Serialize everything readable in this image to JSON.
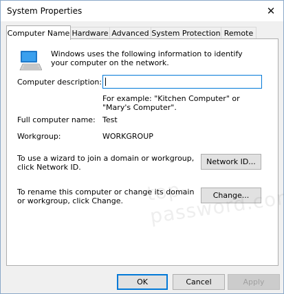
{
  "window": {
    "title": "System Properties"
  },
  "tabs": [
    {
      "label": "Computer Name",
      "active": true
    },
    {
      "label": "Hardware"
    },
    {
      "label": "Advanced"
    },
    {
      "label": "System Protection"
    },
    {
      "label": "Remote"
    }
  ],
  "computer_name": {
    "intro": "Windows uses the following information to identify your computer on the network.",
    "description_label": "Computer description:",
    "description_value": "",
    "description_example": "For example: \"Kitchen Computer\" or \"Mary's Computer\".",
    "full_name_label": "Full computer name:",
    "full_name_value": "Test",
    "workgroup_label": "Workgroup:",
    "workgroup_value": "WORKGROUP",
    "network_id_text": "To use a wizard to join a domain or workgroup, click Network ID.",
    "network_id_button": "Network ID...",
    "change_text": "To rename this computer or change its domain or workgroup, click Change.",
    "change_button": "Change..."
  },
  "watermark": "top-password.com",
  "footer": {
    "ok": "OK",
    "cancel": "Cancel",
    "apply": "Apply"
  },
  "icons": {
    "close": "close-icon",
    "computer": "computer-icon"
  }
}
